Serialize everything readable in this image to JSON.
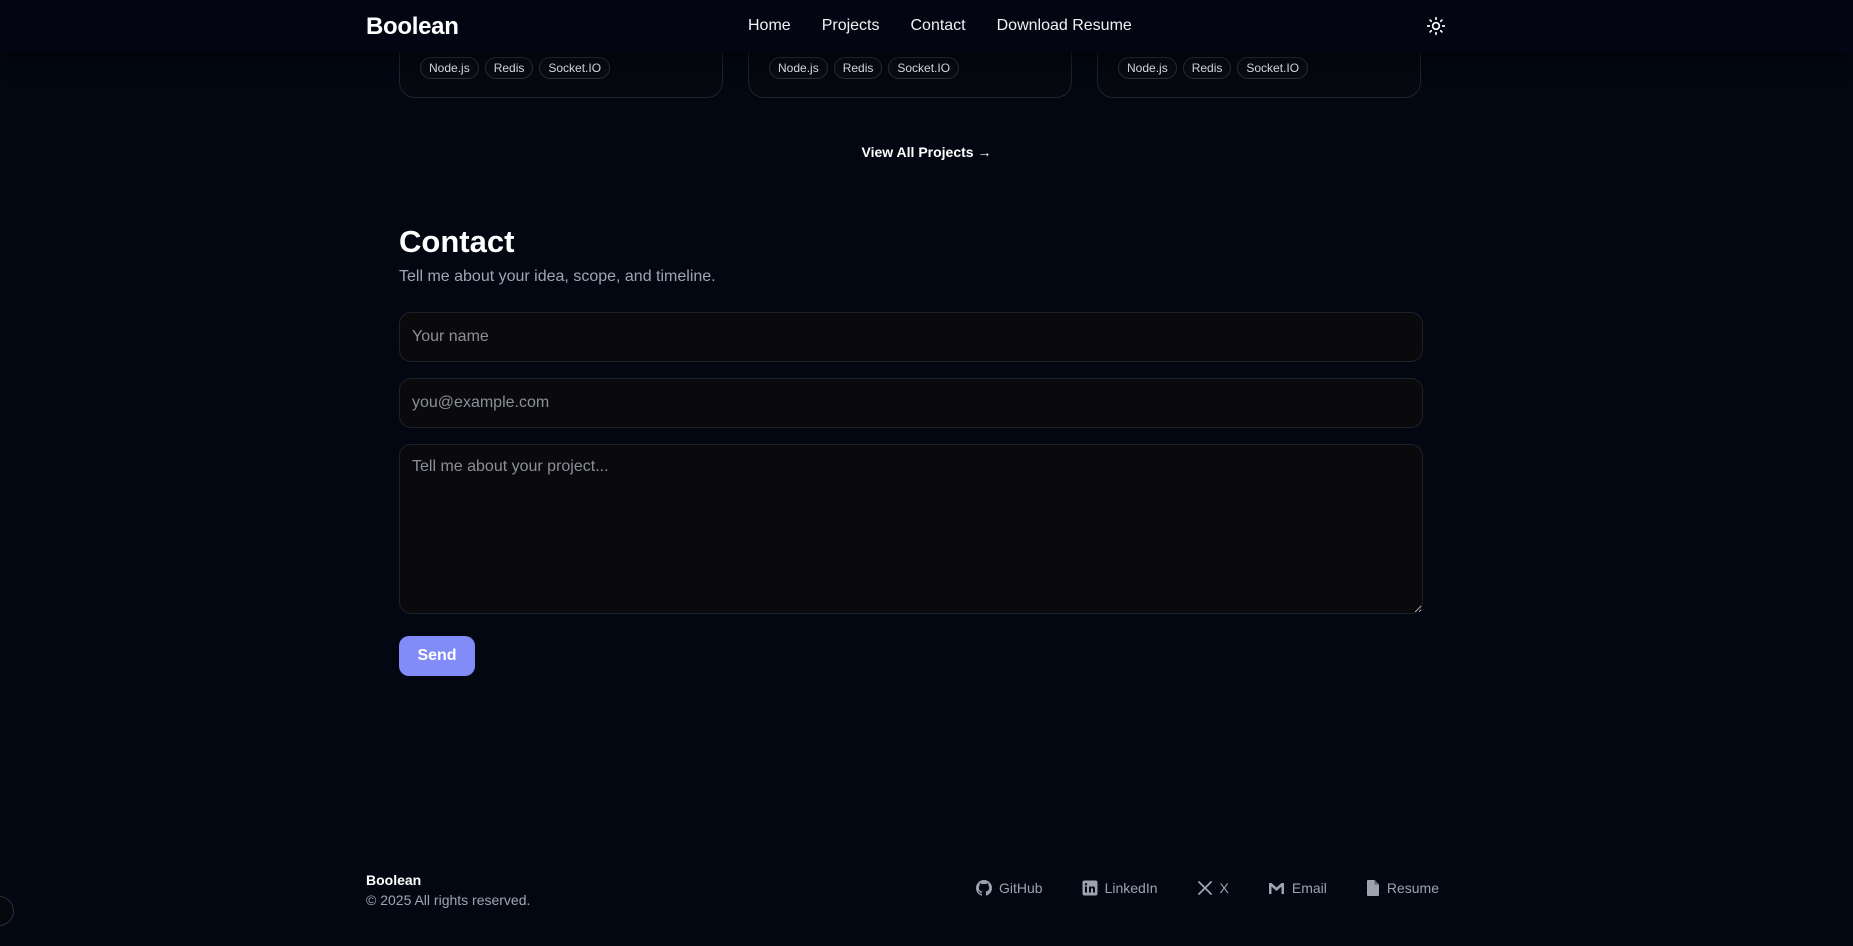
{
  "navbar": {
    "brand": "Boolean",
    "links": [
      "Home",
      "Projects",
      "Contact",
      "Download Resume"
    ],
    "theme_icon": "sun-icon"
  },
  "projects": {
    "cards": [
      {
        "tags": [
          "Node.js",
          "Redis",
          "Socket.IO"
        ]
      },
      {
        "tags": [
          "Node.js",
          "Redis",
          "Socket.IO"
        ]
      },
      {
        "tags": [
          "Node.js",
          "Redis",
          "Socket.IO"
        ]
      }
    ],
    "view_all_label": "View All Projects →"
  },
  "contact": {
    "title": "Contact",
    "subtitle": "Tell me about your idea, scope, and timeline.",
    "name_placeholder": "Your name",
    "email_placeholder": "you@example.com",
    "message_placeholder": "Tell me about your project...",
    "send_label": "Send"
  },
  "footer": {
    "brand": "Boolean",
    "copyright": "© 2025 All rights reserved.",
    "links": [
      {
        "label": "GitHub",
        "icon": "github-icon"
      },
      {
        "label": "LinkedIn",
        "icon": "linkedin-icon"
      },
      {
        "label": "X",
        "icon": "x-icon"
      },
      {
        "label": "Email",
        "icon": "mail-icon"
      },
      {
        "label": "Resume",
        "icon": "file-icon"
      }
    ]
  },
  "colors": {
    "background": "#030712",
    "accent": "#818cf8",
    "muted_text": "#a0a5b3"
  }
}
